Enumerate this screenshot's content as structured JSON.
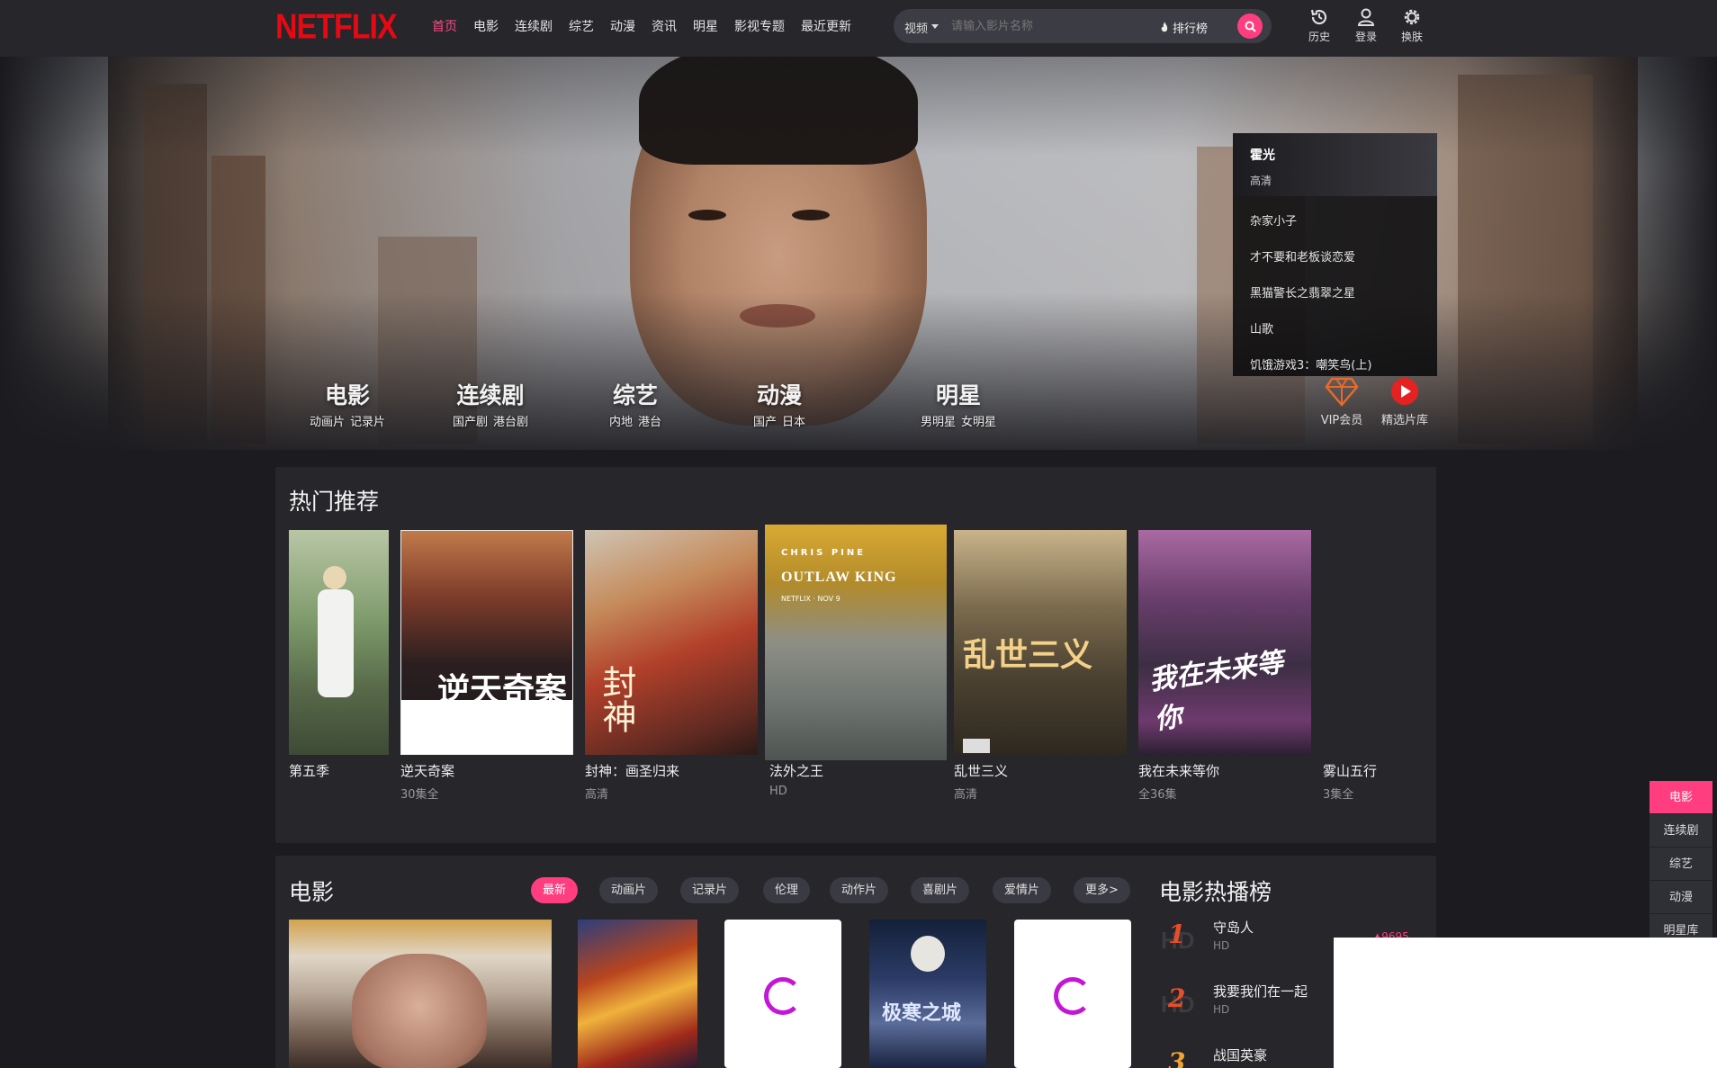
{
  "header": {
    "logo": "NETFLIX",
    "nav": [
      "首页",
      "电影",
      "连续剧",
      "综艺",
      "动漫",
      "资讯",
      "明星",
      "影视专题",
      "最近更新"
    ],
    "search": {
      "category": "视频",
      "placeholder": "请输入影片名称",
      "rank_label": "排行榜"
    },
    "icons": [
      {
        "icon": "history-icon",
        "label": "历史"
      },
      {
        "icon": "user-icon",
        "label": "登录"
      },
      {
        "icon": "skin-icon",
        "label": "换肤"
      }
    ],
    "colors": {
      "brand": "#e50914",
      "accent": "#ff3d7f"
    }
  },
  "hero": {
    "categories": [
      {
        "title": "电影",
        "subs": [
          "动画片",
          "记录片"
        ]
      },
      {
        "title": "连续剧",
        "subs": [
          "国产剧",
          "港台剧"
        ]
      },
      {
        "title": "综艺",
        "subs": [
          "内地",
          "港台"
        ]
      },
      {
        "title": "动漫",
        "subs": [
          "国产",
          "日本"
        ]
      },
      {
        "title": "明星",
        "subs": [
          "男明星",
          "女明星"
        ]
      }
    ],
    "featured": {
      "title": "霍光",
      "subtitle": "高清"
    },
    "list": [
      "杂家小子",
      "才不要和老板谈恋爱",
      "黑猫警长之翡翠之星",
      "山歌",
      "饥饿游戏3：嘲笑鸟(上)"
    ],
    "badges": [
      {
        "icon": "diamond-icon",
        "label": "VIP会员"
      },
      {
        "icon": "play-icon",
        "label": "精选片库"
      }
    ]
  },
  "hot": {
    "title": "热门推荐",
    "items": [
      {
        "title": "第五季",
        "sub": ""
      },
      {
        "title": "逆天奇案",
        "sub": "30集全"
      },
      {
        "title": "封神：画圣归来",
        "sub": "高清"
      },
      {
        "title": "法外之王",
        "sub": "HD"
      },
      {
        "title": "乱世三义",
        "sub": "高清"
      },
      {
        "title": "我在未来等你",
        "sub": "全36集"
      },
      {
        "title": "雾山五行",
        "sub": "3集全"
      }
    ],
    "poster_text": {
      "p2": "逆天奇案",
      "p3": "封神",
      "p4_top": "CHRIS PINE",
      "p4_title": "OUTLAW KING",
      "p4_net": "NETFLIX · NOV 9",
      "p5": "乱世三义",
      "p6": "我在未来等你"
    }
  },
  "movies": {
    "title": "电影",
    "tags": [
      "最新",
      "动画片",
      "记录片",
      "伦理",
      "动作片",
      "喜剧片",
      "爱情片",
      "更多>"
    ],
    "poster_text": {
      "p4": "极寒之城"
    }
  },
  "rank": {
    "title": "电影热播榜",
    "items": [
      {
        "num": "1",
        "title": "守岛人",
        "sub": "HD",
        "heat": "▲9695"
      },
      {
        "num": "2",
        "title": "我要我们在一起",
        "sub": "HD"
      },
      {
        "num": "3",
        "title": "战国英豪",
        "sub": ""
      }
    ]
  },
  "float_nav": [
    "电影",
    "连续剧",
    "综艺",
    "动漫",
    "明星库"
  ]
}
